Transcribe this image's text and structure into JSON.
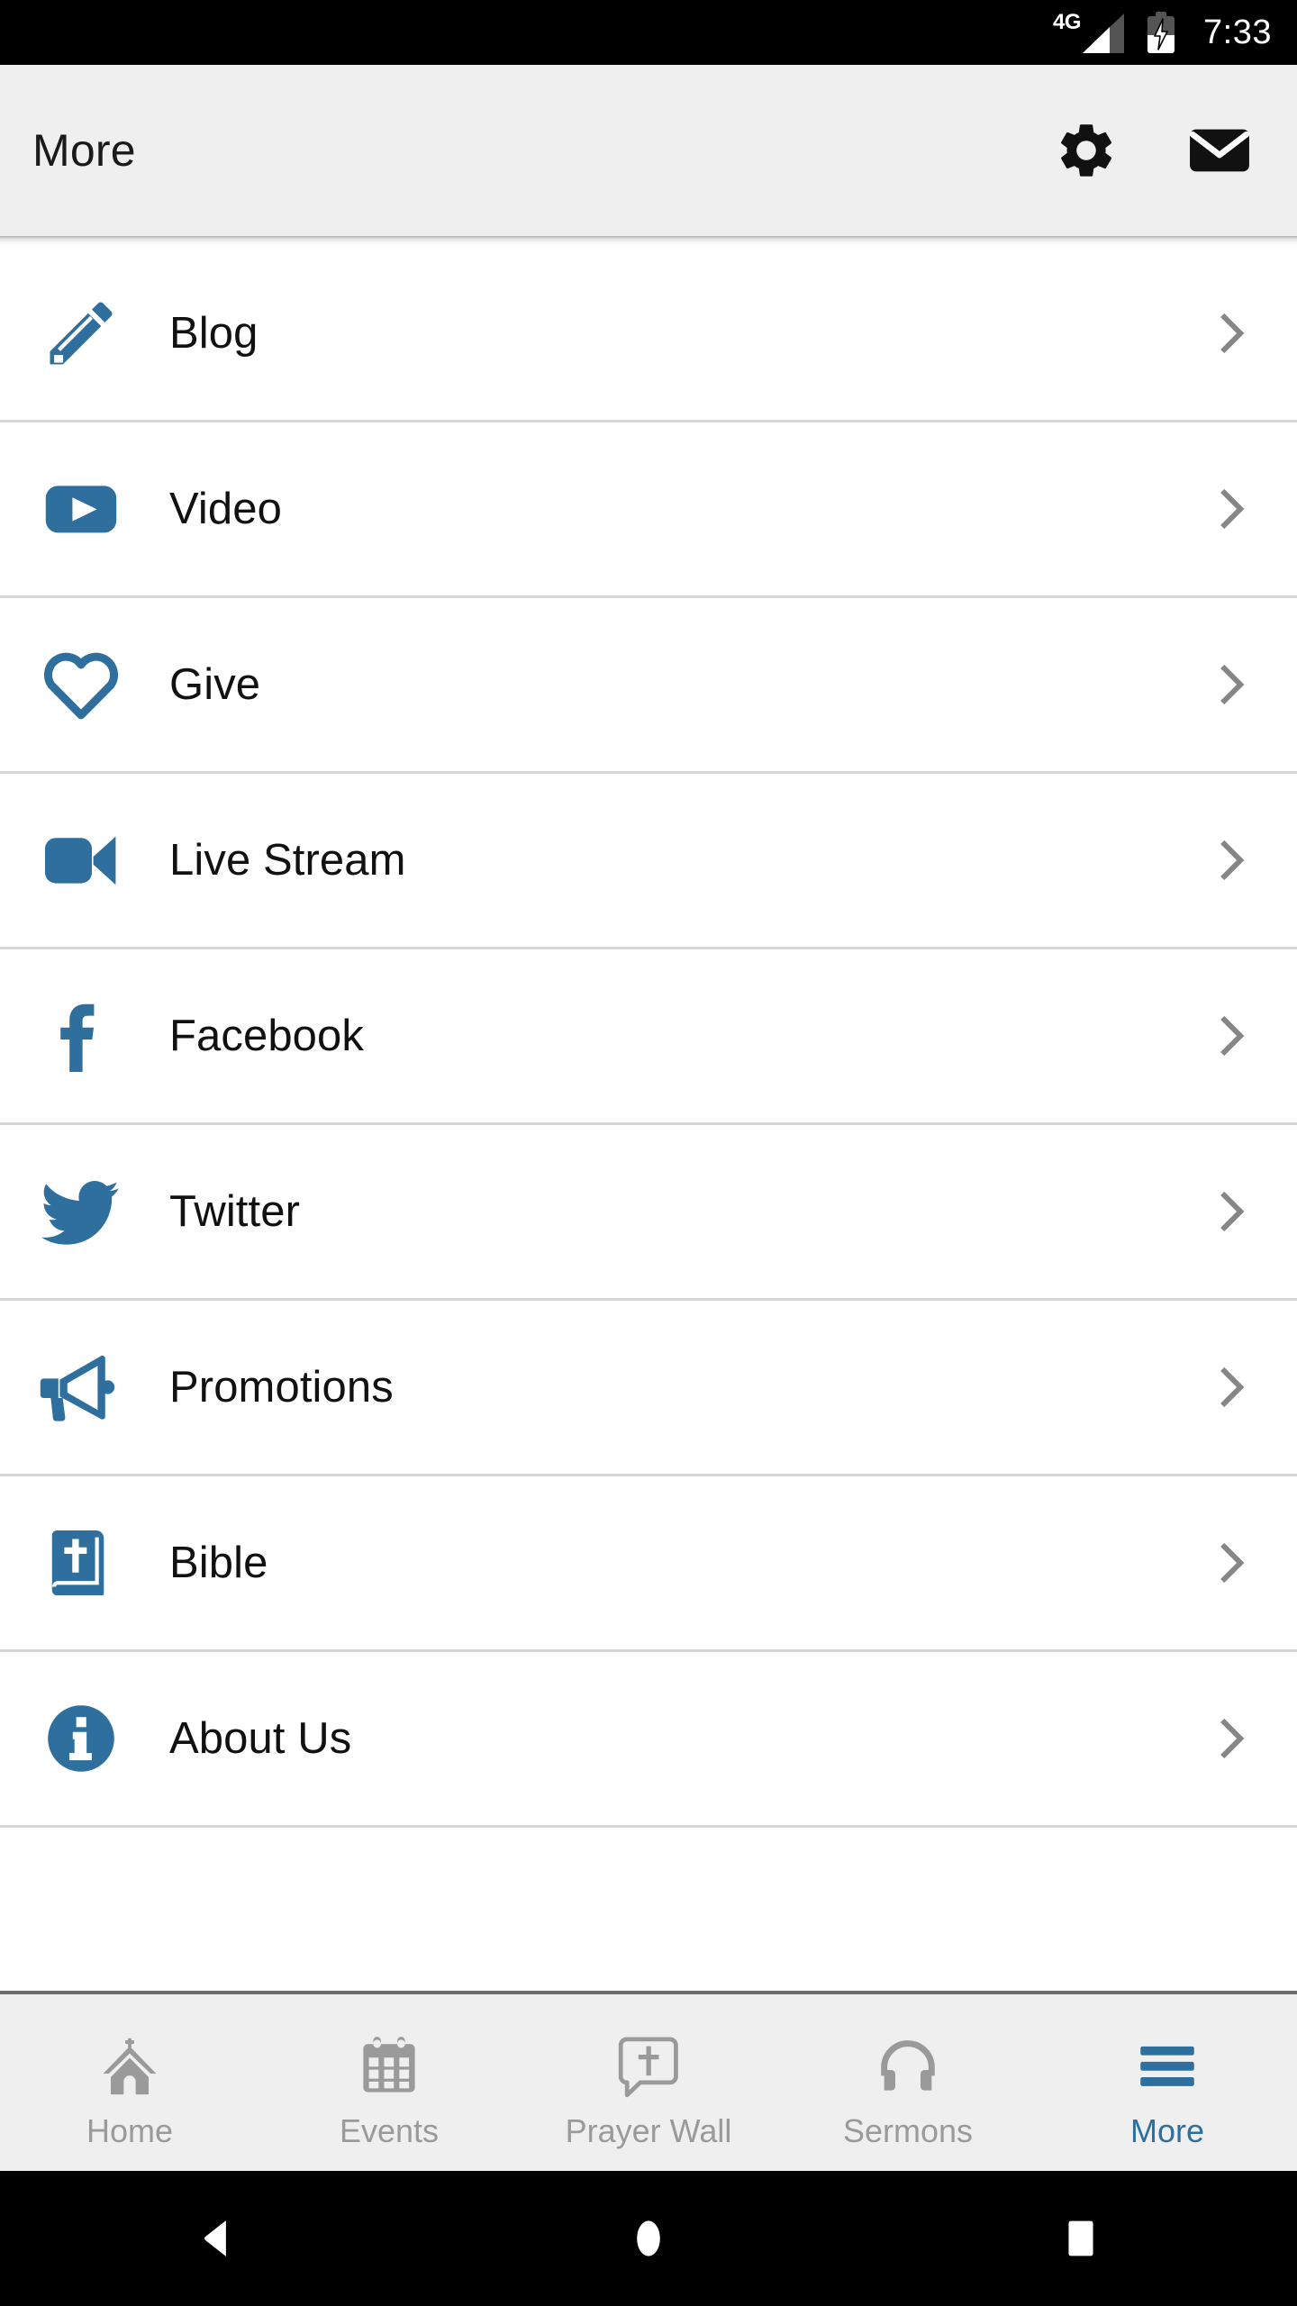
{
  "status_bar": {
    "network_label": "4G",
    "signal_icon": "signal-bars-icon",
    "battery_icon": "battery-charging-icon",
    "time": "7:33"
  },
  "header": {
    "title": "More",
    "settings_icon": "gear-icon",
    "mail_icon": "envelope-icon"
  },
  "colors": {
    "accent_blue": "#2e6f9e",
    "header_bg": "#efefef",
    "divider": "#d6d6d6",
    "chevron": "#868686",
    "tab_inactive": "#9a9a9a",
    "status_bg": "#000000"
  },
  "list": {
    "chevron_icon": "chevron-right-icon",
    "items": [
      {
        "label": "Blog",
        "icon": "pencil-icon"
      },
      {
        "label": "Video",
        "icon": "play-button-icon"
      },
      {
        "label": "Give",
        "icon": "heart-outline-icon"
      },
      {
        "label": "Live Stream",
        "icon": "video-camera-icon"
      },
      {
        "label": "Facebook",
        "icon": "facebook-icon"
      },
      {
        "label": "Twitter",
        "icon": "twitter-bird-icon"
      },
      {
        "label": "Promotions",
        "icon": "megaphone-icon"
      },
      {
        "label": "Bible",
        "icon": "bible-book-icon"
      },
      {
        "label": "About Us",
        "icon": "info-circle-icon"
      }
    ]
  },
  "tab_bar": {
    "items": [
      {
        "label": "Home",
        "icon": "church-icon",
        "active": false
      },
      {
        "label": "Events",
        "icon": "calendar-icon",
        "active": false
      },
      {
        "label": "Prayer Wall",
        "icon": "prayer-bubble-icon",
        "active": false
      },
      {
        "label": "Sermons",
        "icon": "headphones-icon",
        "active": false
      },
      {
        "label": "More",
        "icon": "hamburger-icon",
        "active": true
      }
    ]
  },
  "system_nav": {
    "back_icon": "back-triangle-icon",
    "home_icon": "home-circle-icon",
    "recents_icon": "recents-square-icon"
  }
}
